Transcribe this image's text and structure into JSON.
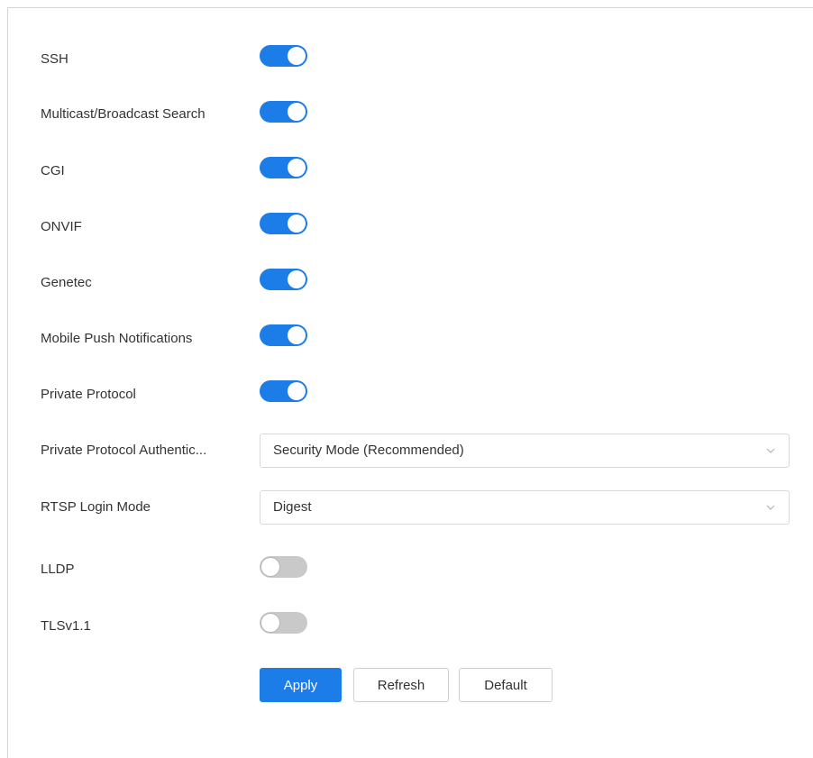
{
  "settings": {
    "ssh": {
      "label": "SSH",
      "enabled": true
    },
    "multicast": {
      "label": "Multicast/Broadcast Search",
      "enabled": true
    },
    "cgi": {
      "label": "CGI",
      "enabled": true
    },
    "onvif": {
      "label": "ONVIF",
      "enabled": true
    },
    "genetec": {
      "label": "Genetec",
      "enabled": true
    },
    "mobile_push": {
      "label": "Mobile Push Notifications",
      "enabled": true
    },
    "private_protocol": {
      "label": "Private Protocol",
      "enabled": true
    },
    "private_protocol_auth": {
      "label": "Private Protocol Authentic...",
      "value": "Security Mode (Recommended)"
    },
    "rtsp_login": {
      "label": "RTSP Login Mode",
      "value": "Digest"
    },
    "lldp": {
      "label": "LLDP",
      "enabled": false
    },
    "tls": {
      "label": "TLSv1.1",
      "enabled": false
    }
  },
  "buttons": {
    "apply": "Apply",
    "refresh": "Refresh",
    "default": "Default"
  },
  "colors": {
    "accent": "#1c7ce8",
    "toggle_off": "#c9c9c9"
  }
}
